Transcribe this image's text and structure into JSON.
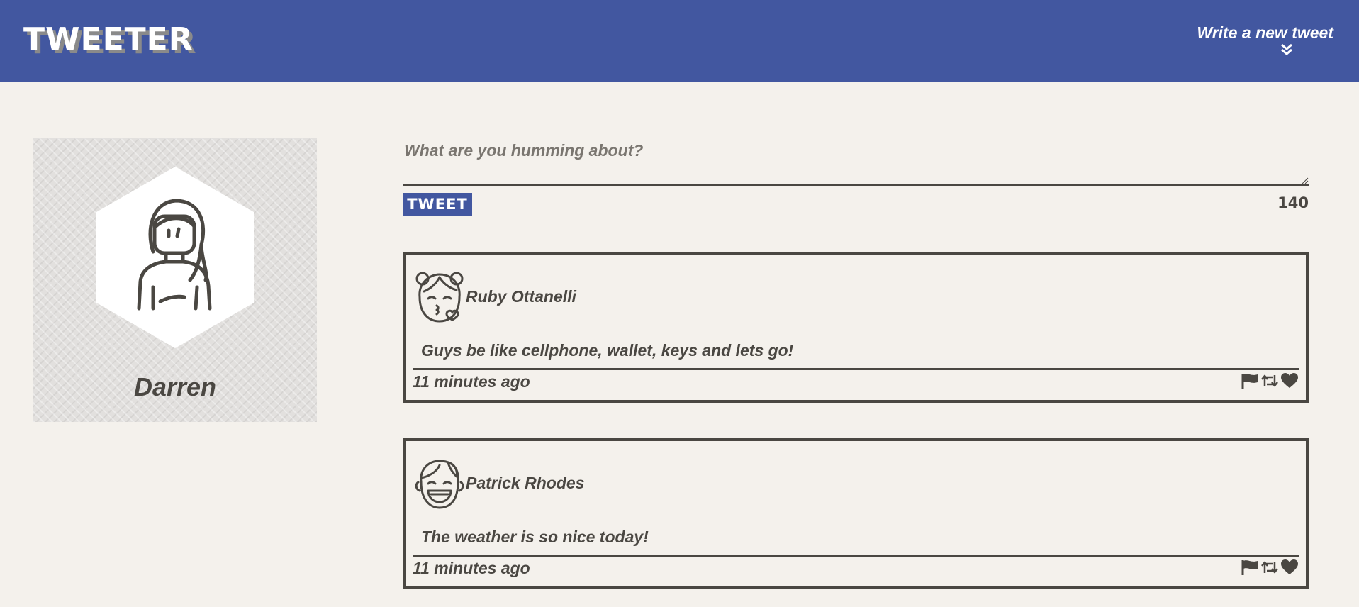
{
  "nav": {
    "logo": "TWEETER",
    "compose_label": "Write a new tweet",
    "compose_icon": "double-chevron-down-icon"
  },
  "profile": {
    "name": "Darren",
    "avatar_icon": "woman-avatar-icon"
  },
  "composer": {
    "placeholder": "What are you humming about?",
    "value": "",
    "button_label": "TWEET",
    "counter": "140"
  },
  "tweets": [
    {
      "user": "Ruby Ottanelli",
      "avatar_icon": "kissing-girl-avatar-icon",
      "text": "Guys be like cellphone, wallet, keys and lets go!",
      "time": "11 minutes ago"
    },
    {
      "user": "Patrick Rhodes",
      "avatar_icon": "laughing-boy-avatar-icon",
      "text": "The weather is so nice today!",
      "time": "11 minutes ago"
    }
  ],
  "tweet_actions": [
    "flag-icon",
    "retweet-icon",
    "heart-icon"
  ],
  "colors": {
    "nav": "#4257a0",
    "background": "#f4f1ec",
    "text": "#4a4742",
    "button": "#4257a0"
  }
}
